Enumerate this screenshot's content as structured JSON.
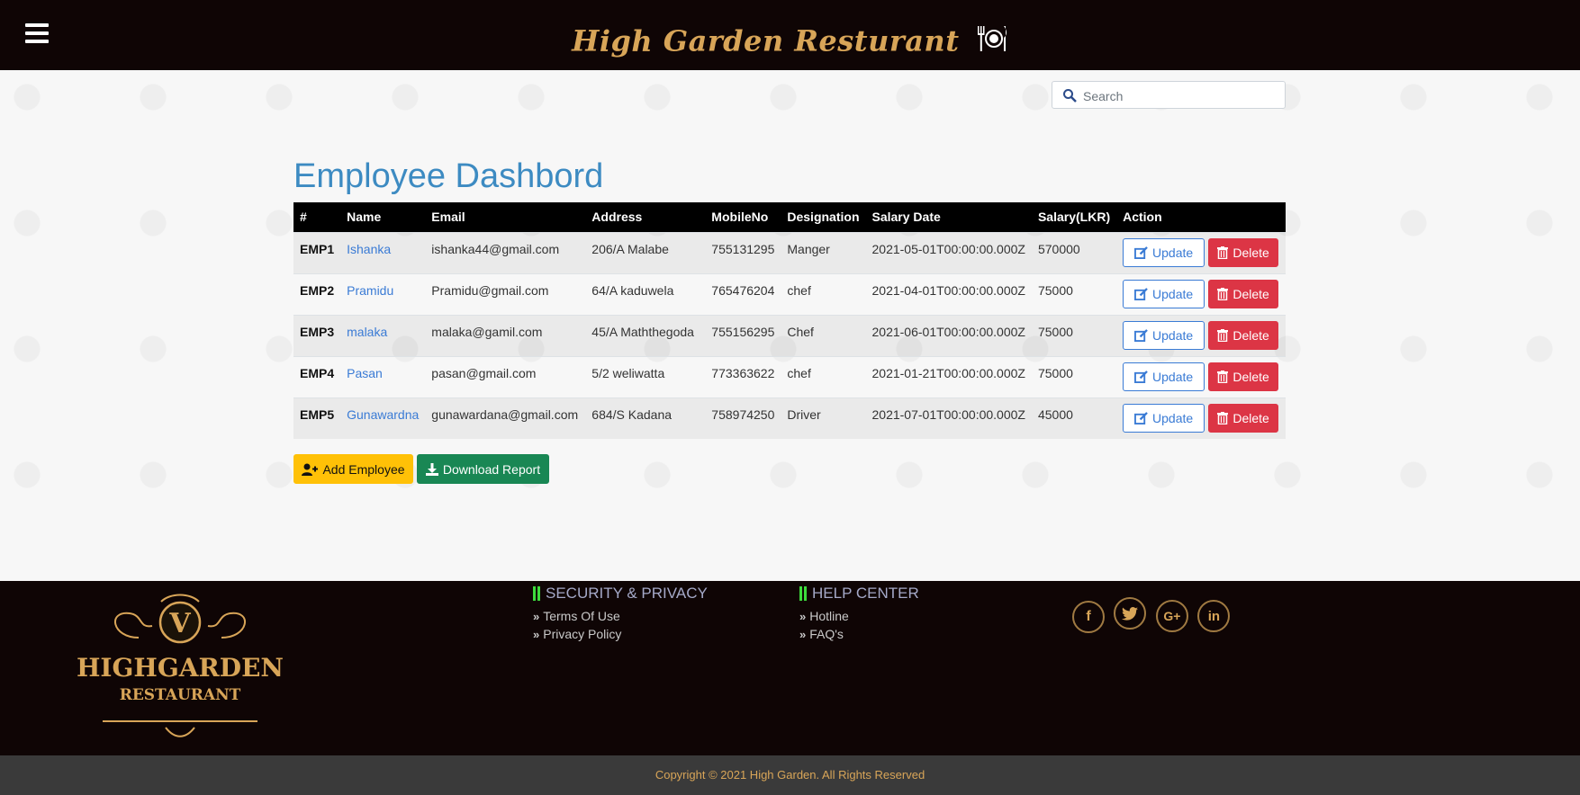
{
  "header": {
    "brand_title": "High Garden Resturant",
    "icon_color": "#ffffff",
    "title_color": "#d8a558"
  },
  "search": {
    "placeholder": "Search"
  },
  "page": {
    "title": "Employee Dashbord"
  },
  "table": {
    "columns": [
      "#",
      "Name",
      "Email",
      "Address",
      "MobileNo",
      "Designation",
      "Salary Date",
      "Salary(LKR)",
      "Action"
    ],
    "rows": [
      {
        "id": "EMP1",
        "name": "Ishanka",
        "email": "ishanka44@gmail.com",
        "address": "206/A Malabe",
        "mobile": "755131295",
        "designation": "Manger",
        "salary_date": "2021-05-01T00:00:00.000Z",
        "salary": "570000"
      },
      {
        "id": "EMP2",
        "name": "Pramidu",
        "email": "Pramidu@gmail.com",
        "address": "64/A kaduwela",
        "mobile": "765476204",
        "designation": "chef",
        "salary_date": "2021-04-01T00:00:00.000Z",
        "salary": "75000"
      },
      {
        "id": "EMP3",
        "name": "malaka",
        "email": "malaka@gamil.com",
        "address": "45/A Maththegoda",
        "mobile": "755156295",
        "designation": "Chef",
        "salary_date": "2021-06-01T00:00:00.000Z",
        "salary": "75000"
      },
      {
        "id": "EMP4",
        "name": "Pasan",
        "email": "pasan@gmail.com",
        "address": "5/2 weliwatta",
        "mobile": "773363622",
        "designation": "chef",
        "salary_date": "2021-01-21T00:00:00.000Z",
        "salary": "75000"
      },
      {
        "id": "EMP5",
        "name": "Gunawardna",
        "email": "gunawardana@gmail.com",
        "address": "684/S Kadana",
        "mobile": "758974250",
        "designation": "Driver",
        "salary_date": "2021-07-01T00:00:00.000Z",
        "salary": "45000"
      }
    ],
    "update_label": "Update",
    "delete_label": "Delete"
  },
  "actions": {
    "add_employee": "Add Employee",
    "download_report": "Download Report"
  },
  "footer": {
    "logo_letter": "V",
    "logo_line1": "HIGHGARDEN",
    "logo_line2": "RESTAURANT",
    "security": {
      "title": "SECURITY & PRIVACY",
      "links": [
        "Terms Of Use",
        "Privacy Policy"
      ]
    },
    "help": {
      "title": "HELP CENTER",
      "links": [
        "Hotline",
        "FAQ's"
      ]
    },
    "social": [
      "facebook-icon",
      "twitter-icon",
      "google-plus-icon",
      "linkedin-icon"
    ],
    "copyright": "Copyright © 2021 High Garden. All Rights Reserved"
  },
  "colors": {
    "dark_bg": "#0f0505",
    "gold": "#d8a558",
    "title_blue": "#3d8bc2",
    "link_blue": "#3a7bd5",
    "delete_red": "#dc3545",
    "add_yellow": "#ffc107",
    "download_green": "#198754"
  }
}
